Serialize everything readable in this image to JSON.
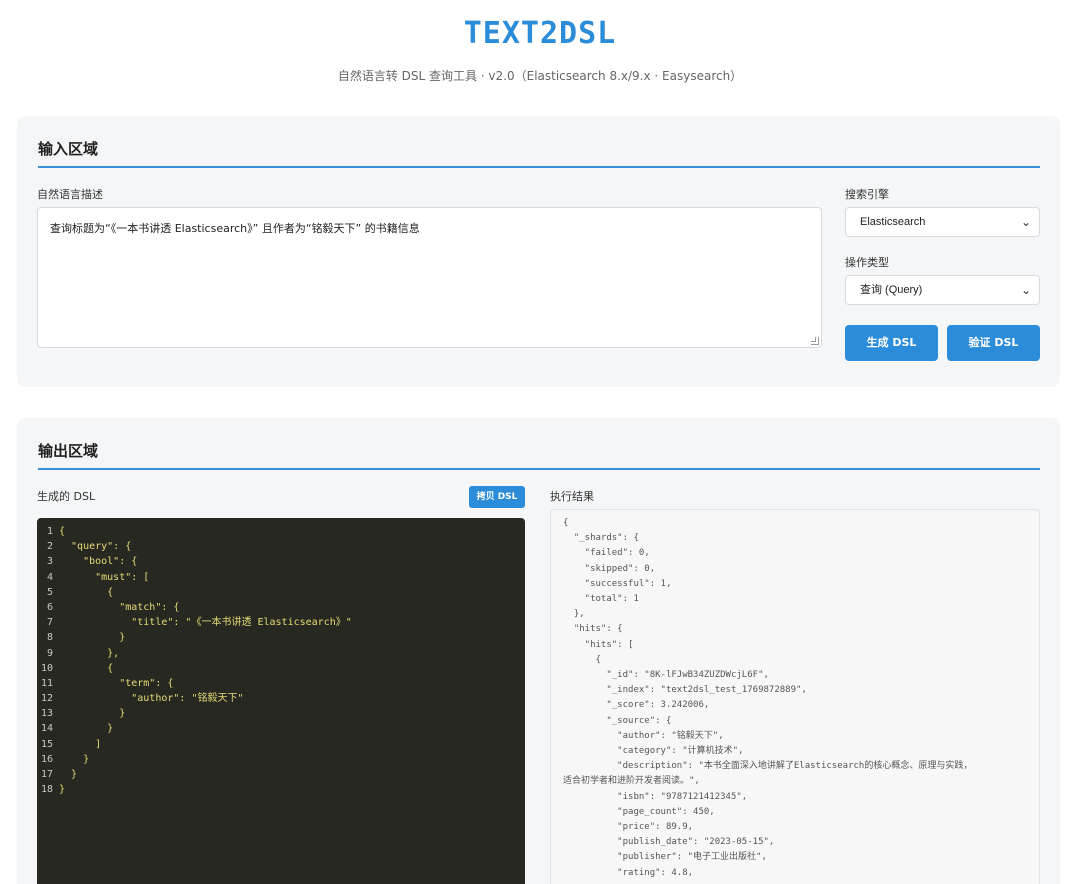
{
  "header": {
    "title": "TEXT2DSL",
    "subtitle": "自然语言转 DSL 查询工具 · v2.0（Elasticsearch 8.x/9.x · Easysearch）"
  },
  "input_section": {
    "title": "输入区域",
    "description_label": "自然语言描述",
    "description_value": "查询标题为“《一本书讲透 Elasticsearch》” 且作者为“铭毅天下” 的书籍信息",
    "engine_label": "搜索引擎",
    "engine_value": "Elasticsearch",
    "operation_label": "操作类型",
    "operation_value": "查询 (Query)",
    "generate_button": "生成 DSL",
    "validate_button": "验证 DSL"
  },
  "output_section": {
    "title": "输出区域",
    "dsl_label": "生成的 DSL",
    "copy_button": "拷贝 DSL",
    "result_label": "执行结果",
    "dsl_lines": [
      {
        "n": "1",
        "t": "{"
      },
      {
        "n": "2",
        "t": "  \"query\": {"
      },
      {
        "n": "3",
        "t": "    \"bool\": {"
      },
      {
        "n": "4",
        "t": "      \"must\": ["
      },
      {
        "n": "5",
        "t": "        {"
      },
      {
        "n": "6",
        "t": "          \"match\": {"
      },
      {
        "n": "7",
        "t": "            \"title\": \"《一本书讲透 Elasticsearch》\""
      },
      {
        "n": "8",
        "t": "          }"
      },
      {
        "n": "9",
        "t": "        },"
      },
      {
        "n": "10",
        "t": "        {"
      },
      {
        "n": "11",
        "t": "          \"term\": {"
      },
      {
        "n": "12",
        "t": "            \"author\": \"铭毅天下\""
      },
      {
        "n": "13",
        "t": "          }"
      },
      {
        "n": "14",
        "t": "        }"
      },
      {
        "n": "15",
        "t": "      ]"
      },
      {
        "n": "16",
        "t": "    }"
      },
      {
        "n": "17",
        "t": "  }"
      },
      {
        "n": "18",
        "t": "}"
      }
    ],
    "result_text": "{\n  \"_shards\": {\n    \"failed\": 0,\n    \"skipped\": 0,\n    \"successful\": 1,\n    \"total\": 1\n  },\n  \"hits\": {\n    \"hits\": [\n      {\n        \"_id\": \"8K-lFJwB34ZUZDWcjL6F\",\n        \"_index\": \"text2dsl_test_1769872889\",\n        \"_score\": 3.242006,\n        \"_source\": {\n          \"author\": \"铭毅天下\",\n          \"category\": \"计算机技术\",\n          \"description\": \"本书全面深入地讲解了Elasticsearch的核心概念、原理与实践，\n适合初学者和进阶开发者阅读。\",\n          \"isbn\": \"9787121412345\",\n          \"page_count\": 450,\n          \"price\": 89.9,\n          \"publish_date\": \"2023-05-15\",\n          \"publisher\": \"电子工业出版社\",\n          \"rating\": 4.8,"
  }
}
